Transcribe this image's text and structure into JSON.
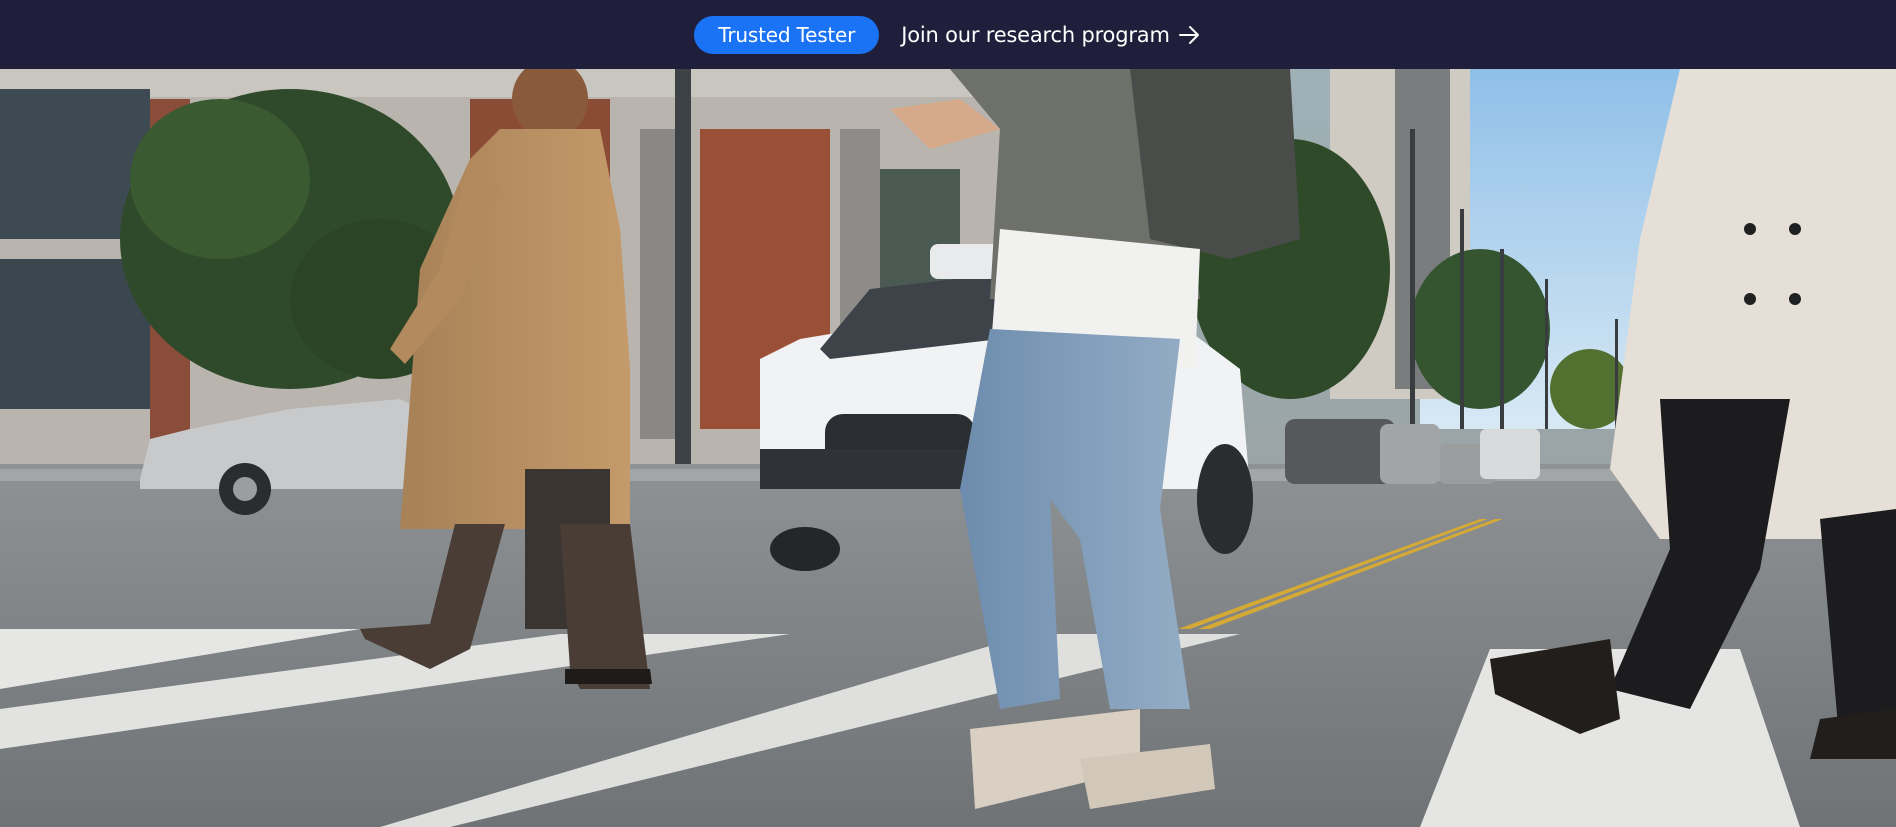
{
  "banner": {
    "pill_label": "Trusted Tester",
    "link_label": "Join our research program",
    "arrow_icon": "arrow-right-icon",
    "colors": {
      "background": "#1f1f3b",
      "pill": "#1a73f5",
      "text": "#ffffff"
    }
  },
  "hero": {
    "media_type": "photo"
  }
}
